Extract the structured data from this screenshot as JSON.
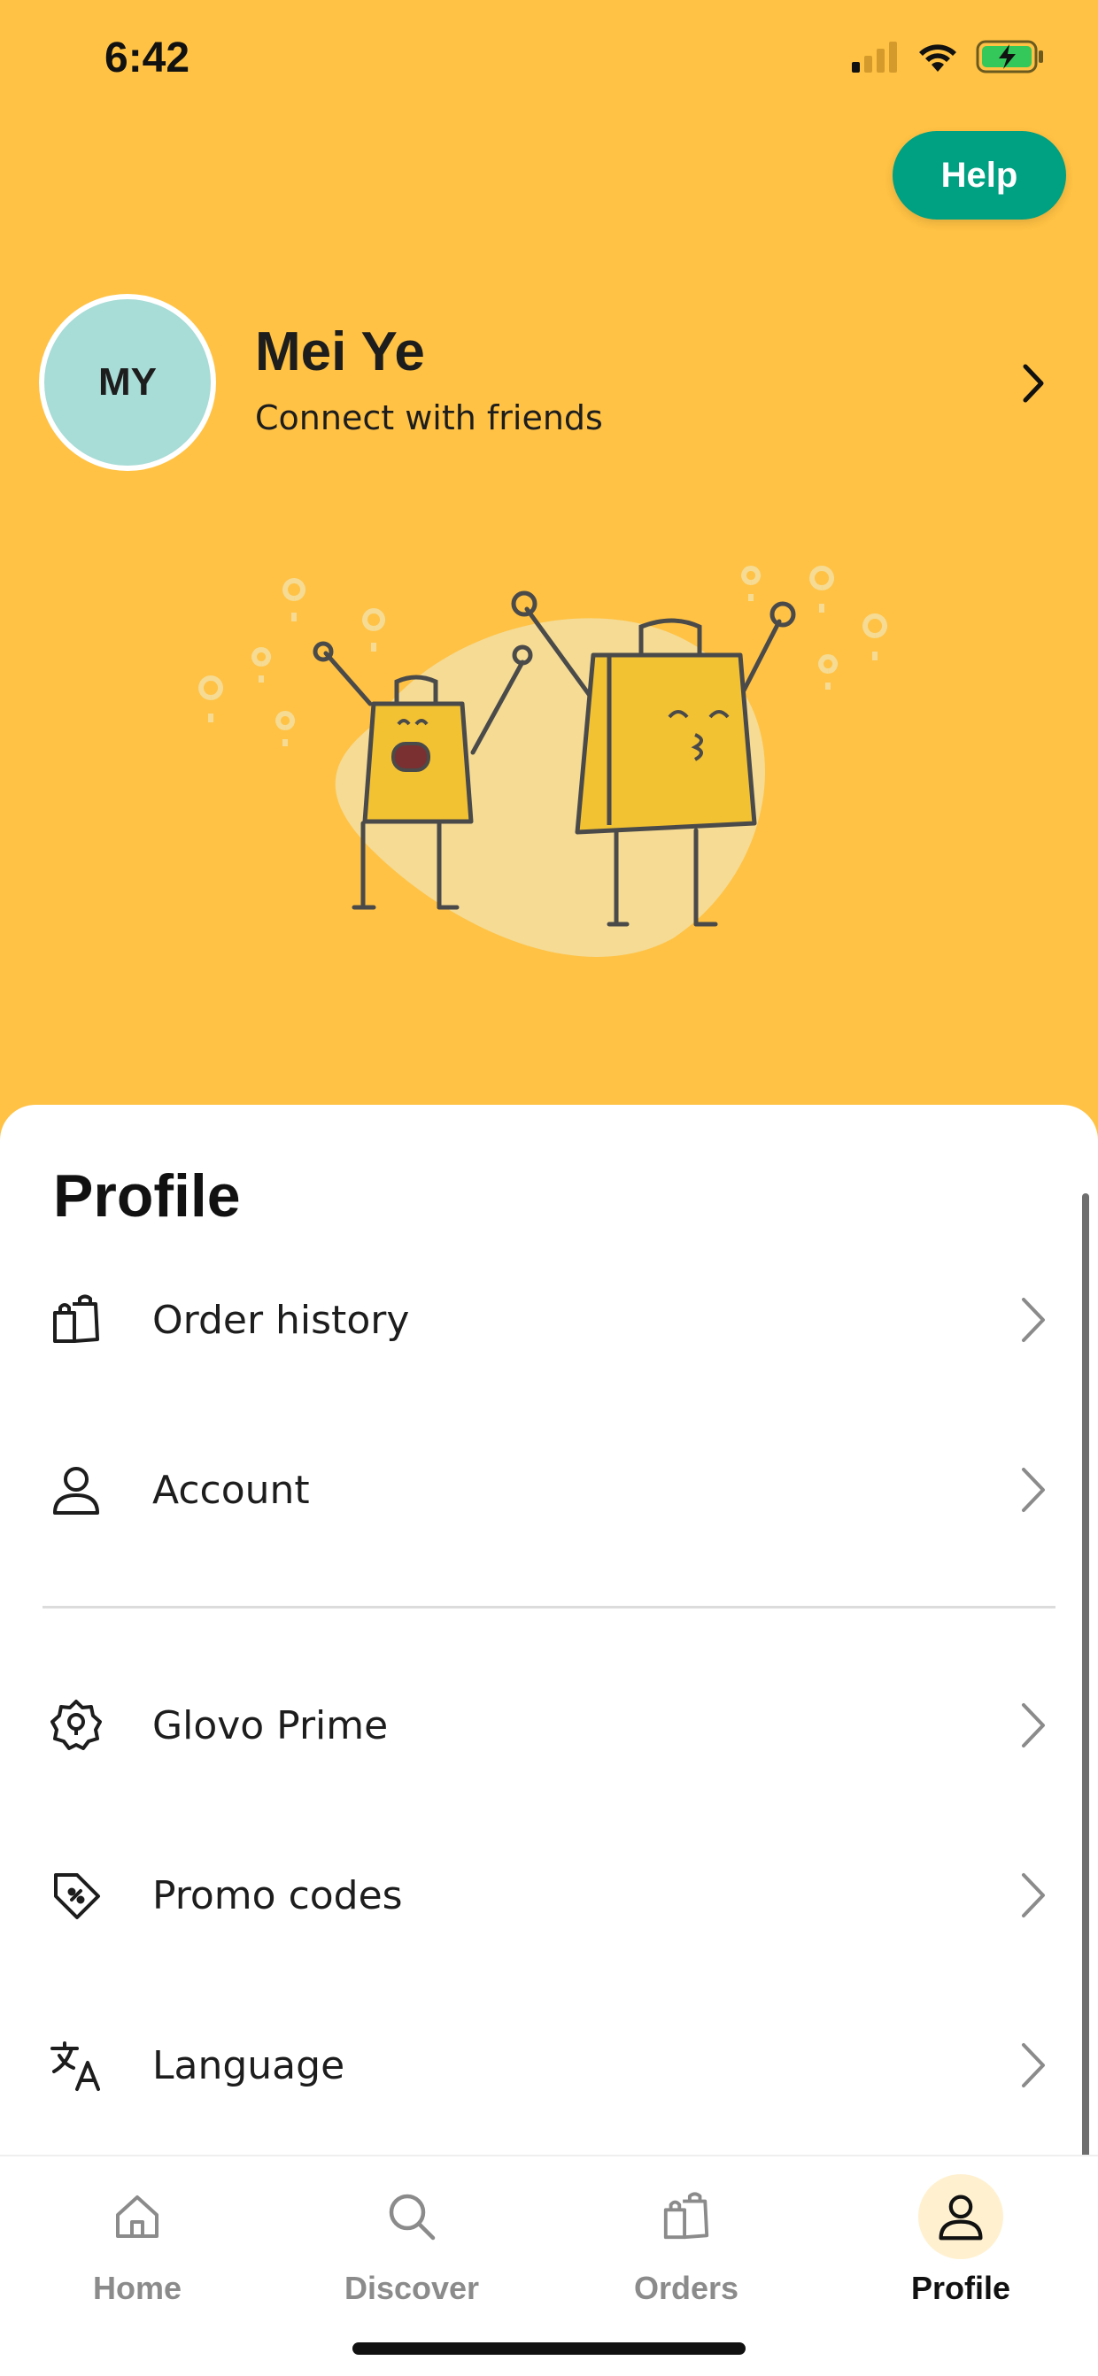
{
  "status_bar": {
    "time": "6:42"
  },
  "header": {
    "help_label": "Help",
    "avatar_initials": "MY",
    "user_name": "Mei Ye",
    "user_subtitle": "Connect with friends"
  },
  "profile": {
    "title": "Profile",
    "items": [
      {
        "label": "Order history",
        "icon": "bags-icon"
      },
      {
        "label": "Account",
        "icon": "person-icon"
      },
      {
        "label": "Glovo Prime",
        "icon": "prime-badge-icon"
      },
      {
        "label": "Promo codes",
        "icon": "promo-tag-icon"
      },
      {
        "label": "Language",
        "icon": "translate-icon"
      }
    ]
  },
  "tabs": [
    {
      "label": "Home",
      "icon": "home-icon",
      "active": false
    },
    {
      "label": "Discover",
      "icon": "search-icon",
      "active": false
    },
    {
      "label": "Orders",
      "icon": "bags-icon",
      "active": false
    },
    {
      "label": "Profile",
      "icon": "person-icon",
      "active": true
    }
  ],
  "colors": {
    "header_background": "#FFC244",
    "help_button": "#00A082",
    "avatar_background": "#A8DCD6",
    "active_tab_highlight": "#FFF1D0"
  }
}
